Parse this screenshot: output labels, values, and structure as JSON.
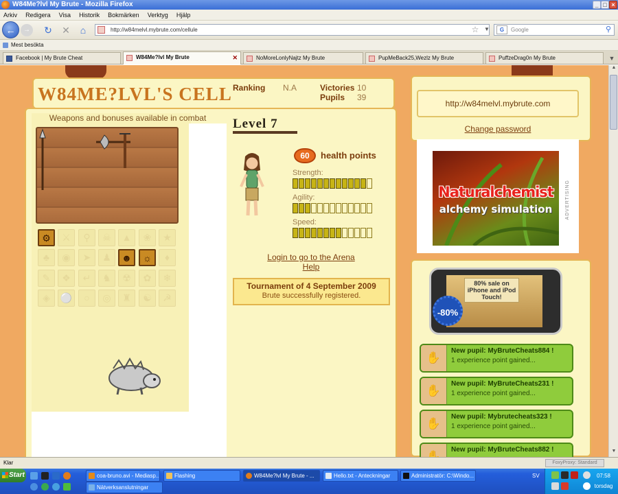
{
  "window": {
    "title": "W84Me?lvl My Brute - Mozilla Firefox"
  },
  "menu": [
    "Arkiv",
    "Redigera",
    "Visa",
    "Historik",
    "Bokmärken",
    "Verktyg",
    "Hjälp"
  ],
  "nav": {
    "url": "http://w84melvl.mybrute.com/cellule",
    "search_placeholder": "Google"
  },
  "bookmarks": {
    "label": "Mest besökta"
  },
  "tabs": [
    {
      "label": "Facebook | My Brute Cheat"
    },
    {
      "label": "W84Me?lvl My Brute"
    },
    {
      "label": "NoMoreLonlyNajtz My Brute"
    },
    {
      "label": "PupMeBack25,Wezlz My Brute"
    },
    {
      "label": "PuffzeDrag0n My Brute"
    }
  ],
  "cell": {
    "title": "W84ME?LVL'S CELL",
    "ranking_label": "Ranking",
    "ranking_value": "N.A",
    "victories_label": "Victories",
    "victories_value": "10",
    "pupils_label": "Pupils",
    "pupils_value": "39"
  },
  "weapons": {
    "title": "Weapons and bonuses available in combat"
  },
  "level": {
    "label": "Level 7"
  },
  "stats": {
    "hp": "60",
    "hp_label": "health points",
    "strength_label": "Strength:",
    "strength": 12,
    "agility_label": "Agility:",
    "agility": 3,
    "speed_label": "Speed:",
    "speed": 8,
    "max": 13
  },
  "links": {
    "login": "Login to go to the Arena",
    "help": "Help"
  },
  "tournament": {
    "title": "Tournament of 4 September 2009",
    "status": "Brute successfully registered."
  },
  "right": {
    "url": "http://w84melvl.mybrute.com",
    "change_password": "Change password",
    "advertising": "ADVERTISING"
  },
  "ad": {
    "line1": "Naturalchemist",
    "line2": "alchemy simulation"
  },
  "phone_ad": {
    "sale": "80% sale on iPhone and iPod Touch!",
    "badge": "-80%"
  },
  "pupils": [
    {
      "title": "New pupil: MyBruteCheats884 !",
      "sub": "1 experience point gained..."
    },
    {
      "title": "New pupil: MyBruteCheats231 !",
      "sub": "1 experience point gained..."
    },
    {
      "title": "New pupil: Mybrutecheats323 !",
      "sub": "1 experience point gained..."
    },
    {
      "title": "New pupil: MyBruteCheats882 !",
      "sub": ""
    }
  ],
  "status": {
    "text": "Klar",
    "foxyproxy": "FoxyProxy: Standard"
  },
  "taskbar": {
    "start": "Start",
    "items": [
      {
        "label": "coa-bruno.avi - Mediasp..."
      },
      {
        "label": "Flashing"
      },
      {
        "label": "W84Me?lvl My Brute - ..."
      },
      {
        "label": "Hello.txt - Anteckningar"
      },
      {
        "label": "Administratör: C:\\Windo..."
      },
      {
        "label": "Nätverksanslutningar"
      }
    ],
    "lang": "SV",
    "time": "07:58",
    "day": "torsdag"
  },
  "colors": {
    "accent": "#c8741f",
    "panel": "#fbf6c4",
    "border": "#e6b656",
    "background": "#f0a961",
    "pupil_green": "#8fcc3c"
  }
}
